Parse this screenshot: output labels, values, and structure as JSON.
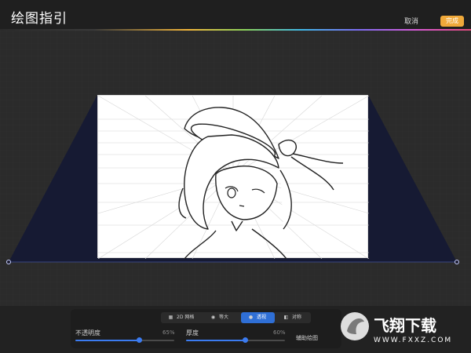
{
  "header": {
    "title": "绘图指引",
    "cancel_label": "取消",
    "done_label": "完成"
  },
  "toolbar": {
    "modes": [
      {
        "label": "2D 网格",
        "icon": "grid-icon",
        "active": false
      },
      {
        "label": "等大",
        "icon": "isometric-icon",
        "active": false
      },
      {
        "label": "透视",
        "icon": "perspective-icon",
        "active": true
      },
      {
        "label": "对称",
        "icon": "symmetry-icon",
        "active": false
      }
    ]
  },
  "controls": {
    "opacity": {
      "label": "不透明度",
      "value_text": "65%",
      "value": 0.65
    },
    "thickness": {
      "label": "厚度",
      "value_text": "60%",
      "value": 0.6
    },
    "assist_label": "辅助绘图"
  },
  "watermark": {
    "brand": "飞翔下载",
    "url": "WWW.FXXZ.COM"
  },
  "colors": {
    "accent": "#f0a93a",
    "active_blue": "#2f6fd6",
    "perspective_fill": "#161a33"
  }
}
